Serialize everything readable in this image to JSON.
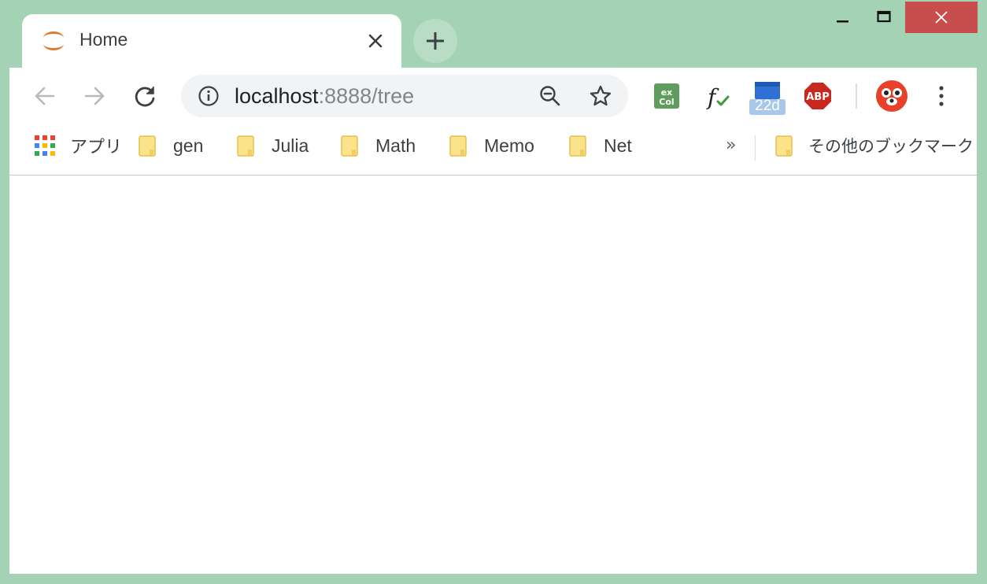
{
  "tab": {
    "title": "Home",
    "icon": "jupyter-logo-icon"
  },
  "window_controls": {
    "minimize": "minimize-icon",
    "maximize": "maximize-icon",
    "close": "close-icon"
  },
  "omnibox": {
    "host": "localhost",
    "rest": ":8888/tree"
  },
  "extensions": {
    "excel_badge": "22d"
  },
  "bookmarks": {
    "apps_label": "アプリ",
    "items": [
      "gen",
      "Julia",
      "Math",
      "Memo",
      "Net"
    ],
    "more": "»",
    "other": "その他のブックマーク"
  },
  "colors": {
    "frame": "#a3d3b4",
    "close_button": "#c84e4e",
    "folder": "#fbe38b"
  }
}
